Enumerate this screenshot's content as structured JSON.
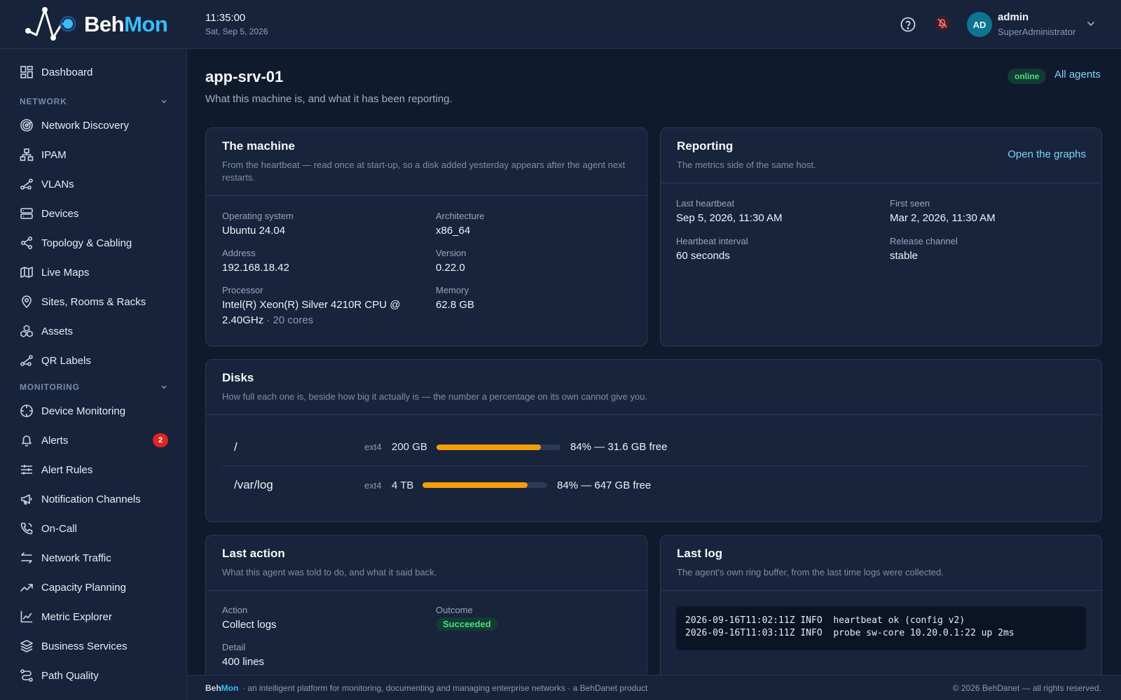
{
  "header": {
    "brand_a": "Beh",
    "brand_b": "Mon",
    "time": "11:35:00",
    "date": "Sat, Sep 5, 2026",
    "user_initials": "AD",
    "user_name": "admin",
    "user_role": "SuperAdministrator"
  },
  "sidebar": {
    "dashboard": "Dashboard",
    "network_section": "NETWORK",
    "network_items": [
      "Network Discovery",
      "IPAM",
      "VLANs",
      "Devices",
      "Topology & Cabling",
      "Live Maps",
      "Sites, Rooms & Racks",
      "Assets",
      "QR Labels"
    ],
    "monitoring_section": "MONITORING",
    "monitoring_items": [
      "Device Monitoring",
      "Alerts",
      "Alert Rules",
      "Notification Channels",
      "On-Call",
      "Network Traffic",
      "Capacity Planning",
      "Metric Explorer",
      "Business Services",
      "Path Quality"
    ],
    "alerts_badge": "2"
  },
  "page": {
    "title": "app-srv-01",
    "subtitle": "What this machine is, and what it has been reporting.",
    "status": "online",
    "all_agents": "All agents"
  },
  "machine": {
    "title": "The machine",
    "desc": "From the heartbeat — read once at start-up, so a disk added yesterday appears after the agent next restarts.",
    "os_label": "Operating system",
    "os": "Ubuntu 24.04",
    "arch_label": "Architecture",
    "arch": "x86_64",
    "address_label": "Address",
    "address": "192.168.18.42",
    "version_label": "Version",
    "version": "0.22.0",
    "processor_label": "Processor",
    "processor": "Intel(R) Xeon(R) Silver 4210R CPU @ 2.40GHz",
    "cores": "· 20 cores",
    "memory_label": "Memory",
    "memory": "62.8 GB"
  },
  "reporting": {
    "title": "Reporting",
    "desc": "The metrics side of the same host.",
    "link": "Open the graphs",
    "last_hb_label": "Last heartbeat",
    "last_hb": "Sep 5, 2026, 11:30 AM",
    "first_seen_label": "First seen",
    "first_seen": "Mar 2, 2026, 11:30 AM",
    "interval_label": "Heartbeat interval",
    "interval": "60 seconds",
    "channel_label": "Release channel",
    "channel": "stable"
  },
  "disks": {
    "title": "Disks",
    "desc": "How full each one is, beside how big it actually is — the number a percentage on its own cannot give you.",
    "rows": [
      {
        "mount": "/",
        "fs": "ext4",
        "size": "200 GB",
        "used_fraction": 0.84,
        "summary": "84% — 31.6 GB free"
      },
      {
        "mount": "/var/log",
        "fs": "ext4",
        "size": "4 TB",
        "used_fraction": 0.84,
        "summary": "84% — 647 GB free"
      }
    ]
  },
  "last_action": {
    "title": "Last action",
    "desc": "What this agent was told to do, and what it said back.",
    "action_label": "Action",
    "action": "Collect logs",
    "outcome_label": "Outcome",
    "outcome": "Succeeded",
    "detail_label": "Detail",
    "detail": "400 lines"
  },
  "last_log": {
    "title": "Last log",
    "desc": "The agent's own ring buffer, from the last time logs were collected.",
    "lines": [
      "2026-09-16T11:02:11Z INFO  heartbeat ok (config v2)",
      "2026-09-16T11:03:11Z INFO  probe sw-core 10.20.0.1:22 up 2ms"
    ]
  },
  "footer": {
    "brand_a": "Beh",
    "brand_b": "Mon",
    "tagline": "· an intelligent platform for monitoring, documenting and managing enterprise networks · a BehDanet product",
    "copyright": "© 2026 BehDanet — all rights reserved."
  },
  "colors": {
    "accent": "#38bdf8",
    "bar_fill": "#f59e0b",
    "success": "#4ade80",
    "badge": "#dc2626"
  }
}
